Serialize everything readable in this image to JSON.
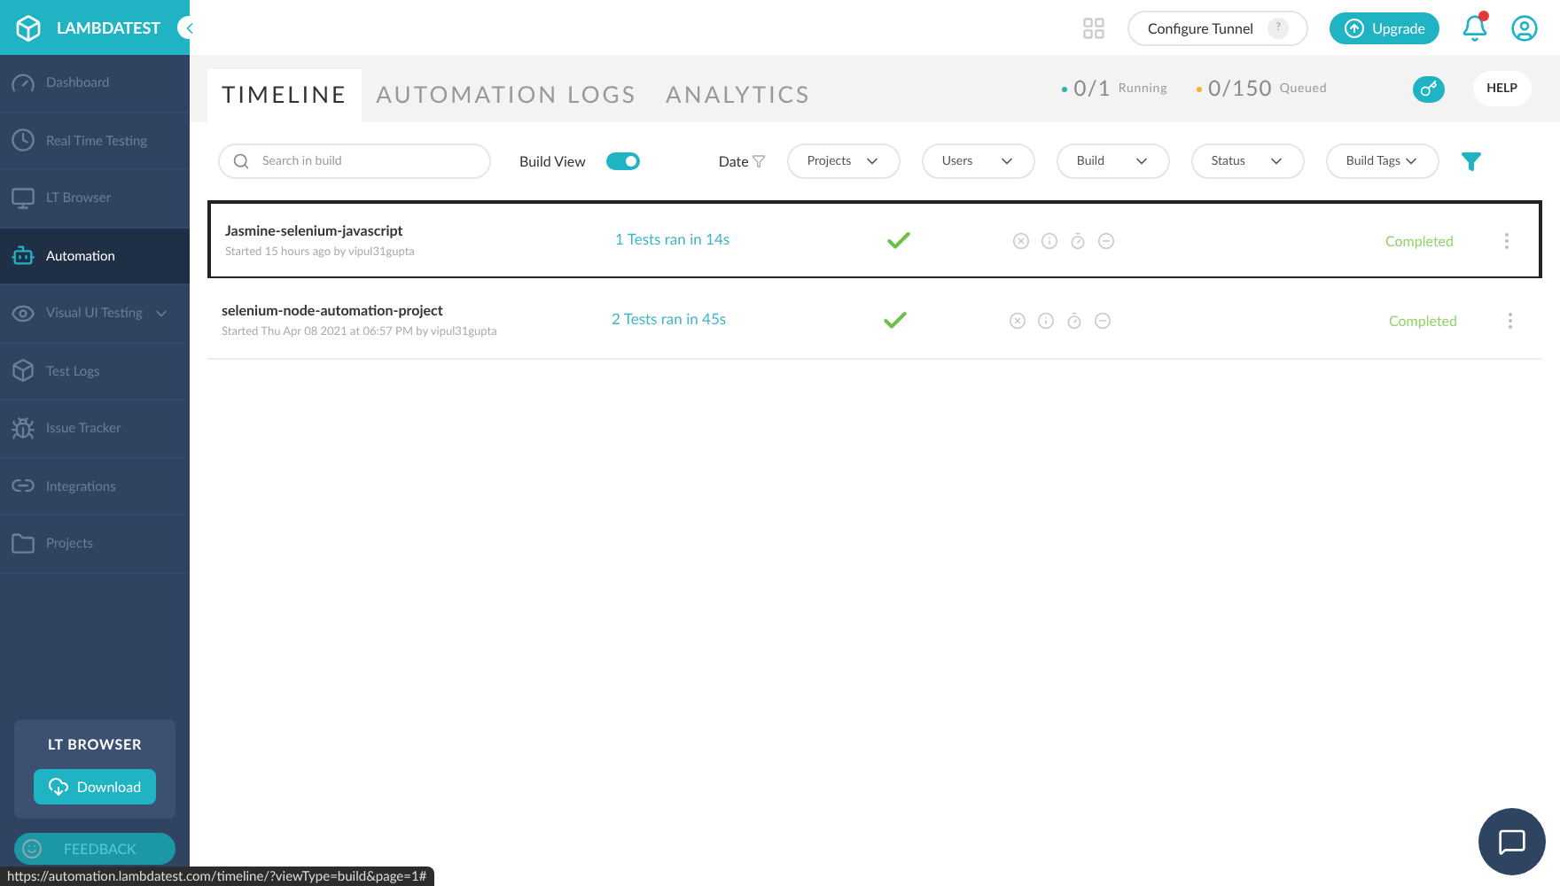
{
  "brand": "LAMBDATEST",
  "sidebar": {
    "items": [
      {
        "label": "Dashboard",
        "kind": "dashboard",
        "selected": false
      },
      {
        "label": "Real Time Testing",
        "kind": "realtime",
        "selected": false
      },
      {
        "label": "LT Browser",
        "kind": "browser",
        "selected": false
      },
      {
        "label": "Automation",
        "kind": "automation",
        "selected": true
      },
      {
        "label": "Visual UI Testing",
        "kind": "visual",
        "selected": false,
        "has_submenu": true
      },
      {
        "label": "Test Logs",
        "kind": "logs",
        "selected": false
      },
      {
        "label": "Issue Tracker",
        "kind": "bug",
        "selected": false
      },
      {
        "label": "Integrations",
        "kind": "integrations",
        "selected": false
      },
      {
        "label": "Projects",
        "kind": "projects",
        "selected": false
      }
    ],
    "promo": {
      "title": "LT BROWSER",
      "button": "Download"
    },
    "feedback": "FEEDBACK"
  },
  "topbar": {
    "configure_tunnel": "Configure Tunnel",
    "help_mark": "?",
    "upgrade": "Upgrade",
    "notification": true
  },
  "tabs": [
    {
      "label": "TIMELINE",
      "selected": true
    },
    {
      "label": "AUTOMATION LOGS",
      "selected": false
    },
    {
      "label": "ANALYTICS",
      "selected": false
    }
  ],
  "stats": [
    {
      "value": "0/1",
      "label": "Running",
      "color": "#2bb5a6"
    },
    {
      "value": "0/150",
      "label": "Queued",
      "color": "#f0b43c"
    }
  ],
  "help": "HELP",
  "filters": {
    "search_placeholder": "Search in build",
    "build_view_label": "Build View",
    "build_view_on": true,
    "date": "Date",
    "dropdowns": [
      "Projects",
      "Users",
      "Build",
      "Status",
      "Build Tags"
    ]
  },
  "builds": [
    {
      "name": "Jasmine-selenium-javascript",
      "meta": "Started 15 hours ago by vipul31gupta",
      "tests": "1 Tests ran in 14s",
      "status": "Completed",
      "selected": true
    },
    {
      "name": "selenium-node-automation-project",
      "meta": "Started Thu Apr 08 2021 at 06:57 PM by vipul31gupta",
      "tests": "2 Tests ran in 45s",
      "status": "Completed",
      "selected": false
    }
  ],
  "status_url": "https://automation.lambdatest.com/timeline/?viewType=build&page=1#"
}
